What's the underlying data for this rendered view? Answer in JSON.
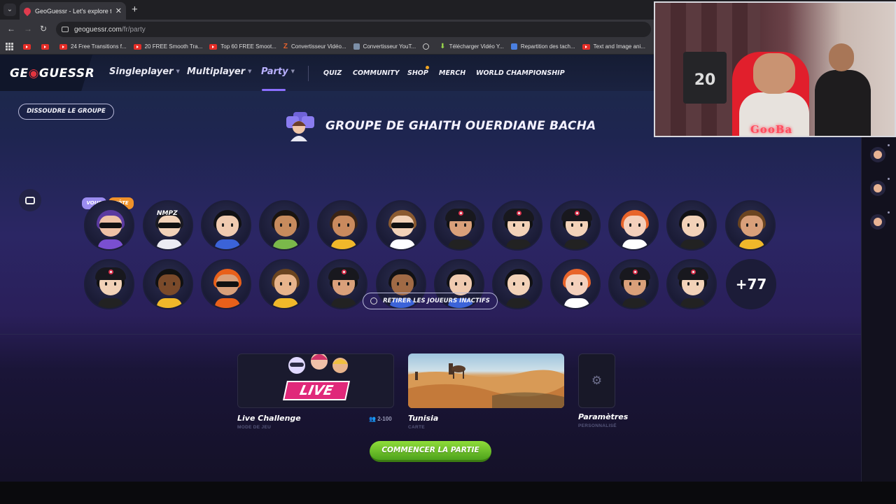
{
  "browser": {
    "tab_title": "GeoGuessr - Let's explore the w",
    "url_domain": "geoguessr.com",
    "url_path": "/fr/party",
    "bookmarks": [
      {
        "label": "",
        "icon": "youtube-icon"
      },
      {
        "label": "",
        "icon": "youtube-icon"
      },
      {
        "label": "24 Free Transitions f...",
        "icon": "youtube-icon"
      },
      {
        "label": "20 FREE Smooth Tra...",
        "icon": "youtube-icon"
      },
      {
        "label": "Top 60 FREE Smoot...",
        "icon": "youtube-icon"
      },
      {
        "label": "Convertisseur Vidéo...",
        "icon": "z-icon"
      },
      {
        "label": "Convertisseur YouT...",
        "icon": "converter-icon"
      },
      {
        "label": "",
        "icon": "globe-icon"
      },
      {
        "label": "Télécharger Vidéo Y...",
        "icon": "download-icon"
      },
      {
        "label": "Repartition des tach...",
        "icon": "docs-icon"
      },
      {
        "label": "Text and Image ani...",
        "icon": "youtube-icon"
      }
    ]
  },
  "nav": {
    "logo_left": "GE",
    "logo_right": "GUESSR",
    "singleplayer": "Singleplayer",
    "multiplayer": "Multiplayer",
    "party": "Party",
    "quiz": "QUIZ",
    "community": "COMMUNITY",
    "shop": "SHOP",
    "merch": "MERCH",
    "world": "WORLD CHAMPIONSHIP"
  },
  "party": {
    "dissolve_label": "DISSOUDRE LE GROUPE",
    "title": "GROUPE DE GHAITH OUERDIANE BACHA",
    "badge_you": "VOUS",
    "badge_host": "HÔTE",
    "more_players": "+77",
    "remove_inactive": "RETIRER LES JOUEURS INACTIFS",
    "avatar_text": "NMPZ"
  },
  "settings_cards": {
    "mode_title": "Live Challenge",
    "mode_sub": "MODE DE JEU",
    "mode_players": "2-100",
    "live_tag": "LIVE",
    "map_title": "Tunisia",
    "map_sub": "CARTE",
    "params_title": "Paramètres",
    "params_sub": "PERSONNALISÉ"
  },
  "start_label": "COMMENCER LA PARTIE",
  "webcam": {
    "overlay_text": "GooBa",
    "jersey_number": "20"
  },
  "colors": {
    "accent_purple": "#8b6fff",
    "start_green": "#5db523",
    "logo_red": "#e2353f",
    "host_orange": "#f0922a",
    "you_lavender": "#9b8cf0"
  }
}
